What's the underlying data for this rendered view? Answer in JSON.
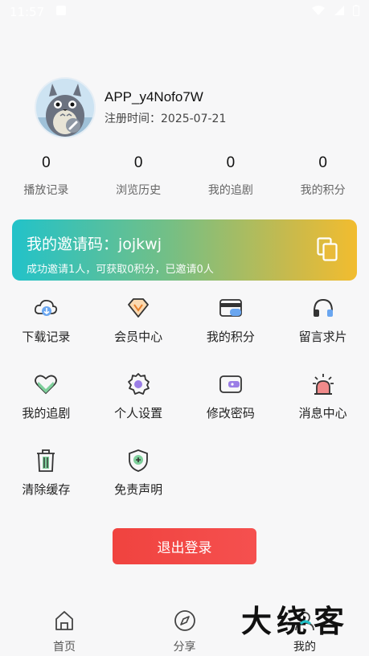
{
  "status_bar": {
    "time": "11:57"
  },
  "profile": {
    "username": "APP_y4Nofo7W",
    "reg_date": "注册时间：2025-07-21"
  },
  "stats": [
    {
      "value": "0",
      "label": "播放记录"
    },
    {
      "value": "0",
      "label": "浏览历史"
    },
    {
      "value": "0",
      "label": "我的追剧"
    },
    {
      "value": "0",
      "label": "我的积分"
    }
  ],
  "invite": {
    "title": "我的邀请码：jojkwj",
    "subtitle": "成功邀请1人，可获取0积分，已邀请0人"
  },
  "menu": [
    {
      "label": "下载记录",
      "icon": "cloud-download-icon"
    },
    {
      "label": "会员中心",
      "icon": "vip-diamond-icon"
    },
    {
      "label": "我的积分",
      "icon": "wallet-card-icon"
    },
    {
      "label": "留言求片",
      "icon": "headphones-icon"
    },
    {
      "label": "我的追剧",
      "icon": "heart-icon"
    },
    {
      "label": "个人设置",
      "icon": "gear-icon"
    },
    {
      "label": "修改密码",
      "icon": "purse-icon"
    },
    {
      "label": "消息中心",
      "icon": "alarm-bell-icon"
    },
    {
      "label": "清除缓存",
      "icon": "trash-icon"
    },
    {
      "label": "免责声明",
      "icon": "shield-icon"
    }
  ],
  "logout_label": "退出登录",
  "tabs": [
    {
      "label": "首页",
      "icon": "home-icon"
    },
    {
      "label": "分享",
      "icon": "compass-icon"
    },
    {
      "label": "我的",
      "icon": "profile-icon"
    }
  ],
  "watermark": {
    "text": "大绕客"
  },
  "colors": {
    "accent_teal": "#22c2c9",
    "accent_yellow": "#f2bc2f",
    "logout_red": "#f0433f",
    "icon_green": "#7ecf9b",
    "icon_blue": "#6aa6f0",
    "icon_dark": "#333333"
  }
}
